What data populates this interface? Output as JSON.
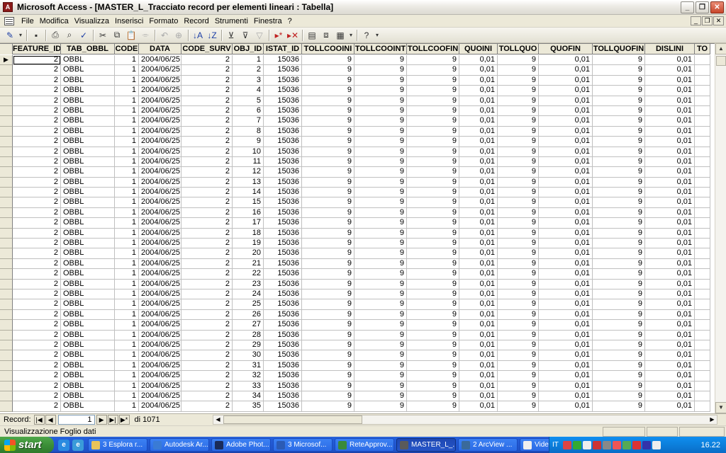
{
  "window": {
    "title": "Microsoft Access - [MASTER_L_Tracciato record per elementi lineari : Tabella]"
  },
  "menu": [
    "File",
    "Modifica",
    "Visualizza",
    "Inserisci",
    "Formato",
    "Record",
    "Strumenti",
    "Finestra",
    "?"
  ],
  "toolbar_icons": [
    "design-view-icon",
    "save-icon",
    "print-icon",
    "print-preview-icon",
    "spelling-icon",
    "cut-icon",
    "copy-icon",
    "paste-icon",
    "format-painter-icon",
    "undo-icon",
    "hyperlink-icon",
    "sort-ascending-icon",
    "sort-descending-icon",
    "filter-by-selection-icon",
    "filter-by-form-icon",
    "apply-filter-icon",
    "new-record-icon",
    "delete-record-icon",
    "properties-icon",
    "database-window-icon",
    "new-object-icon",
    "help-icon"
  ],
  "columns": [
    "FEATURE_ID",
    "TAB_OBBL",
    "CODE",
    "DATA",
    "CODE_SURV",
    "OBJ_ID",
    "ISTAT_ID",
    "TOLLCOOINI",
    "TOLLCOOINT",
    "TOLLCOOFIN",
    "QUOINI",
    "TOLLQUO",
    "QUOFIN",
    "TOLLQUOFIN",
    "DISLINI",
    "TO"
  ],
  "row_template": {
    "feature_id": "2",
    "tab_obbl": "OBBL",
    "code": "1",
    "data": "2004/06/25",
    "code_surv": "2",
    "istat_id": "15036",
    "tollcooini": "9",
    "tollcooint": "9",
    "tollcoofin": "9",
    "quoini": "0,01",
    "tollquo": "9",
    "quofin": "0,01",
    "tollquofin": "9",
    "dislini": "0,01"
  },
  "rows": [
    "1",
    "2",
    "3",
    "4",
    "5",
    "6",
    "7",
    "8",
    "9",
    "10",
    "11",
    "12",
    "13",
    "14",
    "15",
    "16",
    "17",
    "18",
    "19",
    "20",
    "21",
    "22",
    "23",
    "24",
    "25",
    "26",
    "27",
    "28",
    "29",
    "30",
    "31",
    "32",
    "33",
    "34",
    "35"
  ],
  "navigation": {
    "label": "Record:",
    "current": "1",
    "of_text": "di 1071"
  },
  "status": {
    "text": "Visualizzazione Foglio dati"
  },
  "taskbar": {
    "start": "start",
    "tasks": [
      "3 Esplora r...",
      "Autodesk Ar...",
      "Adobe Phot...",
      "3 Microsof...",
      "ReteApprov...",
      "MASTER_L_...",
      "2 ArcView ...",
      "Video"
    ],
    "language": "IT",
    "clock": "16.22"
  }
}
